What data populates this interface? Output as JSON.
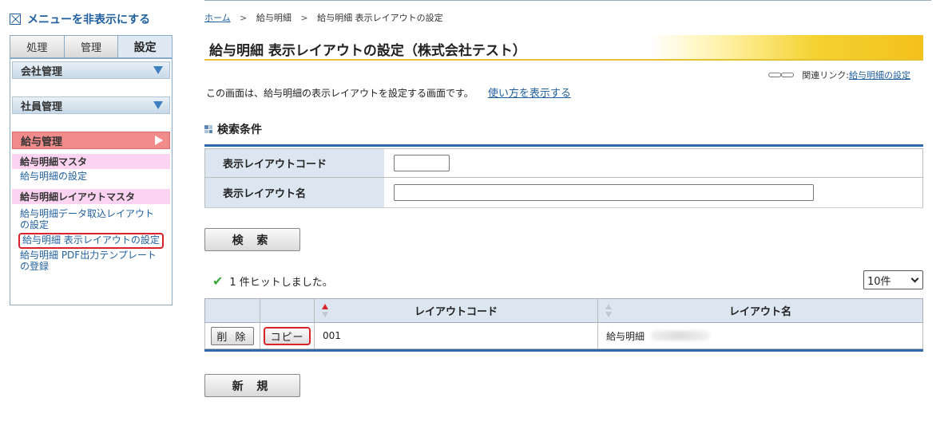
{
  "sidebar": {
    "hide_menu": "メニューを非表示にする",
    "tabs": [
      {
        "label": "処理",
        "active": false
      },
      {
        "label": "管理",
        "active": false
      },
      {
        "label": "設定",
        "active": true
      }
    ],
    "groups": {
      "company": "会社管理",
      "employee": "社員管理",
      "payroll": "給与管理"
    },
    "sections": [
      {
        "heading": "給与明細マスタ",
        "links": [
          "給与明細の設定"
        ]
      },
      {
        "heading": "給与明細レイアウトマスタ",
        "links": [
          "給与明細データ取込レイアウトの設定",
          "給与明細 表示レイアウトの設定",
          "給与明細 PDF出力テンプレートの登録"
        ]
      }
    ]
  },
  "breadcrumb": {
    "home": "ホーム",
    "sep": ">",
    "item1": "給与明細",
    "item2": "給与明細 表示レイアウトの設定"
  },
  "page": {
    "title": "給与明細 表示レイアウトの設定（株式会社テスト）",
    "related_label": "関連リンク:",
    "related_link": "給与明細の設定",
    "description": "この画面は、給与明細の表示レイアウトを設定する画面です。",
    "howto_link": "使い方を表示する"
  },
  "search": {
    "heading": "検索条件",
    "code_label": "表示レイアウトコード",
    "code_value": "",
    "name_label": "表示レイアウト名",
    "name_value": "",
    "button": "検 索"
  },
  "results": {
    "hits": "1 件ヒットしました。",
    "per_page": "10件",
    "columns": {
      "code": "レイアウトコード",
      "name": "レイアウト名"
    },
    "rows": [
      {
        "delete": "削 除",
        "copy": "コピー",
        "code": "001",
        "name": "給与明細"
      }
    ]
  },
  "new_button": "新 規",
  "colors": {
    "accent": "#2e6aa9",
    "highlight": "#d9222a",
    "payroll_group": "#f28c8c",
    "sub_heading": "#fcd3f0"
  }
}
